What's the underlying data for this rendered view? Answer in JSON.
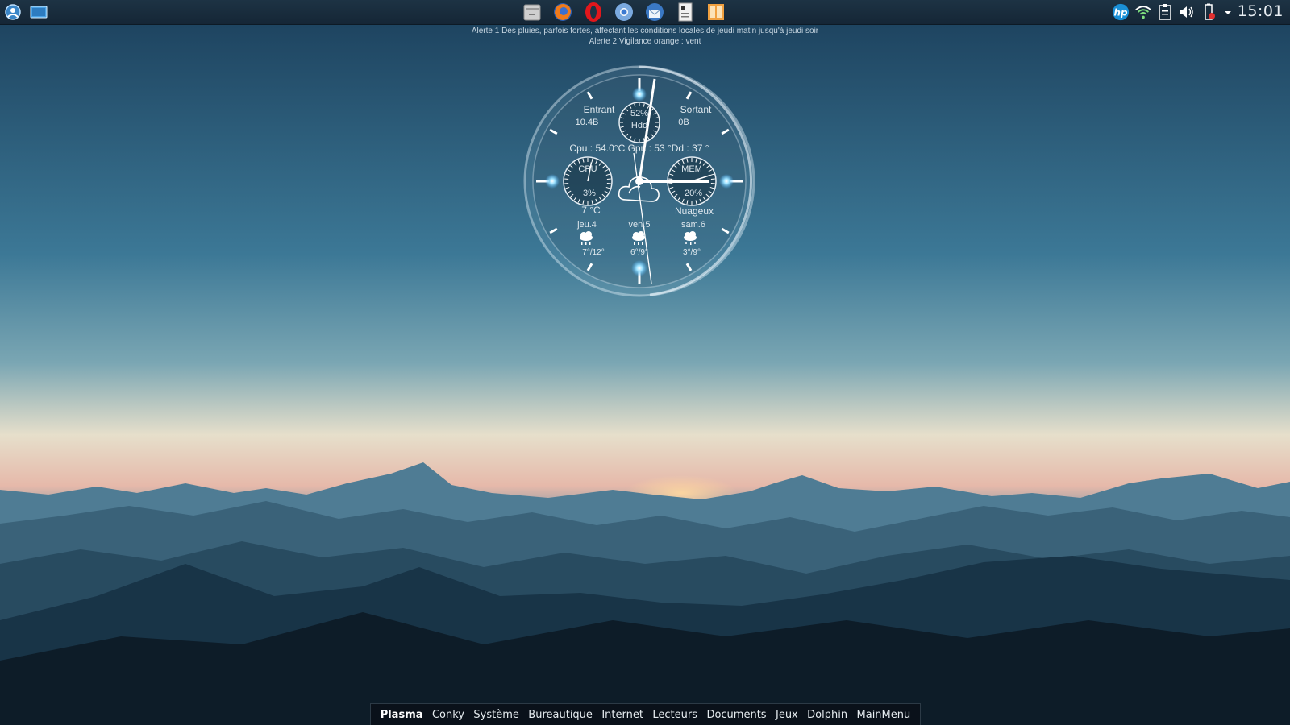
{
  "colors": {
    "panel_bg": "#172a3a",
    "accent_glow": "#7fd6ff",
    "sky_top": "#1d4360",
    "sky_horizon": "#e9dfcb",
    "mountains_dark": "#0c1a26"
  },
  "top_panel": {
    "left_buttons": [
      "kde-launcher-icon",
      "show-desktop-icon"
    ],
    "launchers": [
      "file-manager-icon",
      "firefox-icon",
      "opera-icon",
      "chromium-icon",
      "thunderbird-icon",
      "text-editor-icon",
      "office-icon"
    ],
    "tray": [
      "hp-icon",
      "wifi-icon",
      "clipboard-icon",
      "volume-icon",
      "battery-icon",
      "tray-expand-icon"
    ],
    "clock": "15:01"
  },
  "alerts": {
    "line1": "Alerte 1 Des pluies, parfois fortes, affectant les conditions locales de jeudi matin jusqu'à jeudi soir",
    "line2": "Alerte 2 Vigilance orange : vent"
  },
  "conky": {
    "network": {
      "in_label": "Entrant",
      "in_value": "10.4B",
      "out_label": "Sortant",
      "out_value": "0B"
    },
    "hdd": {
      "value": "52%",
      "label": "Hdd"
    },
    "temps": "Cpu : 54.0°C Gpu : 53 °Dd : 37 °",
    "cpu": {
      "label": "CPU",
      "value": "3%",
      "level": 0.03
    },
    "mem": {
      "label": "MEM",
      "value": "20%",
      "level": 0.2
    },
    "weather": {
      "temp": "7 °C",
      "condition": "Nuageux"
    },
    "forecast": [
      {
        "day": "jeu.4",
        "range": "7°/12°",
        "icon": "rain-cloud-icon"
      },
      {
        "day": "ven.5",
        "range": "6°/9°",
        "icon": "rain-cloud-icon"
      },
      {
        "day": "sam.6",
        "range": "3°/9°",
        "icon": "sleet-cloud-icon"
      }
    ]
  },
  "bottom_menu": {
    "items": [
      "Plasma",
      "Conky",
      "Système",
      "Bureautique",
      "Internet",
      "Lecteurs",
      "Documents",
      "Jeux",
      "Dolphin",
      "MainMenu"
    ],
    "active": "Plasma"
  }
}
